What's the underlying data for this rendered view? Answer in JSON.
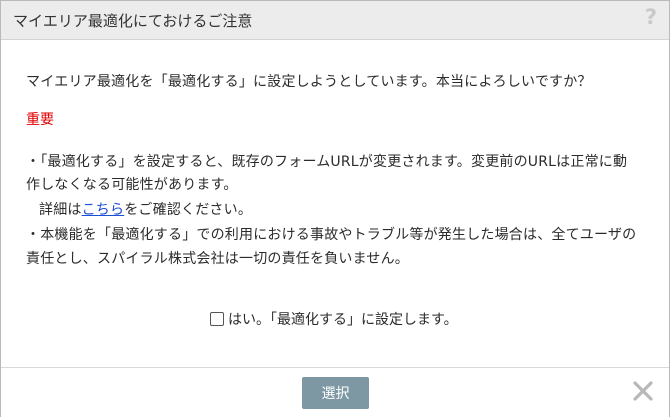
{
  "dialog": {
    "title": "マイエリア最適化にておけるご注意",
    "help_icon": "?",
    "question": "マイエリア最適化を「最適化する」に設定しようとしています。本当によろしいですか？",
    "important_label": "重要",
    "notes": {
      "line1": "・「最適化する」を設定すると、既存のフォームURLが変更されます。変更前のURLは正常に動",
      "line2": "作しなくなる可能性があります。",
      "line3_prefix": "詳細は",
      "line3_link": "こちら",
      "line3_suffix": "をご確認ください。",
      "line4": "・本機能を「最適化する」での利用における事故やトラブル等が発生した場合は、全てユーザの",
      "line5": "責任とし、スパイラル株式会社は一切の責任を負いません。"
    },
    "confirm_checkbox_label": "はい。「最適化する」に設定します。",
    "confirm_checked": false,
    "select_button_label": "選択",
    "colors": {
      "accent_button": "#7e98a3",
      "important_text": "#e00000",
      "link": "#1a4fd6"
    },
    "icons": [
      "help-icon",
      "close-icon"
    ]
  }
}
